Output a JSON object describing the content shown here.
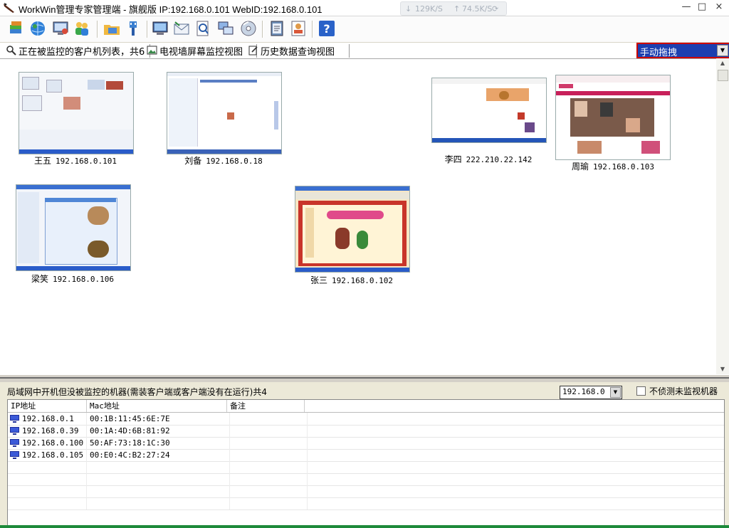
{
  "window": {
    "title": "WorkWin管理专家管理端 - 旗舰版 IP:192.168.0.101 WebID:192.168.0.101",
    "download_speed": "129K/S",
    "upload_speed": "74.5K/S",
    "minimize": "—",
    "restore": "□",
    "close": "×"
  },
  "toolbar": {
    "buttons": [
      "stack-icon",
      "globe-icon",
      "monitor-settings-icon",
      "users-icon",
      "folder-network-icon",
      "usb-icon",
      "screen-icon",
      "email-icon",
      "document-search-icon",
      "remote-screens-icon",
      "disc-icon",
      "report-icon",
      "user-card-icon",
      "help-icon"
    ]
  },
  "tabs": [
    {
      "label": "正在被监控的客户机列表，共6"
    },
    {
      "label": "电视墙屏幕监控视图"
    },
    {
      "label": "历史数据查询视图"
    }
  ],
  "mode_select": {
    "value": "手动拖拽"
  },
  "thumbnails": [
    {
      "name": "王五",
      "ip": "192.168.0.101"
    },
    {
      "name": "刘备",
      "ip": "192.168.0.18"
    },
    {
      "name": "李四",
      "ip": "222.210.22.142"
    },
    {
      "name": "周瑜",
      "ip": "192.168.0.103"
    },
    {
      "name": "梁笑",
      "ip": "192.168.0.106"
    },
    {
      "name": "张三",
      "ip": "192.168.0.102"
    }
  ],
  "lower": {
    "title": "局域网中开机但没被监控的机器(需装客户端或客户端没有在运行)共4",
    "subnet": "192.168.0",
    "checkbox_label": "不侦测未监视机器",
    "columns": [
      "IP地址",
      "Mac地址",
      "备注"
    ],
    "rows": [
      {
        "ip": "192.168.0.1",
        "mac": "00:1B:11:45:6E:7E",
        "note": ""
      },
      {
        "ip": "192.168.0.39",
        "mac": "00:1A:4D:6B:81:92",
        "note": ""
      },
      {
        "ip": "192.168.0.100",
        "mac": "50:AF:73:18:1C:30",
        "note": ""
      },
      {
        "ip": "192.168.0.105",
        "mac": "00:E0:4C:B2:27:24",
        "note": ""
      }
    ]
  }
}
